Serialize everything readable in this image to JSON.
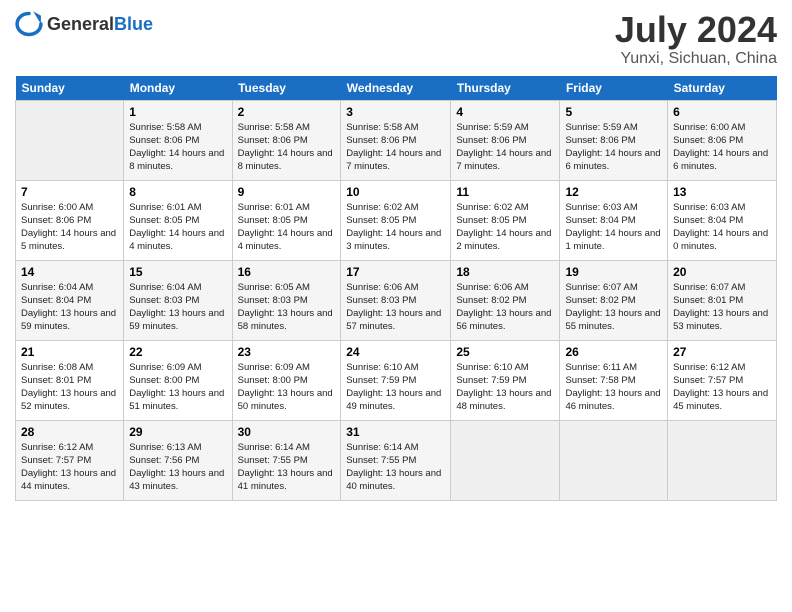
{
  "header": {
    "logo": {
      "general": "General",
      "blue": "Blue"
    },
    "title": "July 2024",
    "subtitle": "Yunxi, Sichuan, China"
  },
  "weekdays": [
    "Sunday",
    "Monday",
    "Tuesday",
    "Wednesday",
    "Thursday",
    "Friday",
    "Saturday"
  ],
  "weeks": [
    [
      {
        "day": "",
        "sunrise": "",
        "sunset": "",
        "daylight": ""
      },
      {
        "day": "1",
        "sunrise": "Sunrise: 5:58 AM",
        "sunset": "Sunset: 8:06 PM",
        "daylight": "Daylight: 14 hours and 8 minutes."
      },
      {
        "day": "2",
        "sunrise": "Sunrise: 5:58 AM",
        "sunset": "Sunset: 8:06 PM",
        "daylight": "Daylight: 14 hours and 8 minutes."
      },
      {
        "day": "3",
        "sunrise": "Sunrise: 5:58 AM",
        "sunset": "Sunset: 8:06 PM",
        "daylight": "Daylight: 14 hours and 7 minutes."
      },
      {
        "day": "4",
        "sunrise": "Sunrise: 5:59 AM",
        "sunset": "Sunset: 8:06 PM",
        "daylight": "Daylight: 14 hours and 7 minutes."
      },
      {
        "day": "5",
        "sunrise": "Sunrise: 5:59 AM",
        "sunset": "Sunset: 8:06 PM",
        "daylight": "Daylight: 14 hours and 6 minutes."
      },
      {
        "day": "6",
        "sunrise": "Sunrise: 6:00 AM",
        "sunset": "Sunset: 8:06 PM",
        "daylight": "Daylight: 14 hours and 6 minutes."
      }
    ],
    [
      {
        "day": "7",
        "sunrise": "Sunrise: 6:00 AM",
        "sunset": "Sunset: 8:06 PM",
        "daylight": "Daylight: 14 hours and 5 minutes."
      },
      {
        "day": "8",
        "sunrise": "Sunrise: 6:01 AM",
        "sunset": "Sunset: 8:05 PM",
        "daylight": "Daylight: 14 hours and 4 minutes."
      },
      {
        "day": "9",
        "sunrise": "Sunrise: 6:01 AM",
        "sunset": "Sunset: 8:05 PM",
        "daylight": "Daylight: 14 hours and 4 minutes."
      },
      {
        "day": "10",
        "sunrise": "Sunrise: 6:02 AM",
        "sunset": "Sunset: 8:05 PM",
        "daylight": "Daylight: 14 hours and 3 minutes."
      },
      {
        "day": "11",
        "sunrise": "Sunrise: 6:02 AM",
        "sunset": "Sunset: 8:05 PM",
        "daylight": "Daylight: 14 hours and 2 minutes."
      },
      {
        "day": "12",
        "sunrise": "Sunrise: 6:03 AM",
        "sunset": "Sunset: 8:04 PM",
        "daylight": "Daylight: 14 hours and 1 minute."
      },
      {
        "day": "13",
        "sunrise": "Sunrise: 6:03 AM",
        "sunset": "Sunset: 8:04 PM",
        "daylight": "Daylight: 14 hours and 0 minutes."
      }
    ],
    [
      {
        "day": "14",
        "sunrise": "Sunrise: 6:04 AM",
        "sunset": "Sunset: 8:04 PM",
        "daylight": "Daylight: 13 hours and 59 minutes."
      },
      {
        "day": "15",
        "sunrise": "Sunrise: 6:04 AM",
        "sunset": "Sunset: 8:03 PM",
        "daylight": "Daylight: 13 hours and 59 minutes."
      },
      {
        "day": "16",
        "sunrise": "Sunrise: 6:05 AM",
        "sunset": "Sunset: 8:03 PM",
        "daylight": "Daylight: 13 hours and 58 minutes."
      },
      {
        "day": "17",
        "sunrise": "Sunrise: 6:06 AM",
        "sunset": "Sunset: 8:03 PM",
        "daylight": "Daylight: 13 hours and 57 minutes."
      },
      {
        "day": "18",
        "sunrise": "Sunrise: 6:06 AM",
        "sunset": "Sunset: 8:02 PM",
        "daylight": "Daylight: 13 hours and 56 minutes."
      },
      {
        "day": "19",
        "sunrise": "Sunrise: 6:07 AM",
        "sunset": "Sunset: 8:02 PM",
        "daylight": "Daylight: 13 hours and 55 minutes."
      },
      {
        "day": "20",
        "sunrise": "Sunrise: 6:07 AM",
        "sunset": "Sunset: 8:01 PM",
        "daylight": "Daylight: 13 hours and 53 minutes."
      }
    ],
    [
      {
        "day": "21",
        "sunrise": "Sunrise: 6:08 AM",
        "sunset": "Sunset: 8:01 PM",
        "daylight": "Daylight: 13 hours and 52 minutes."
      },
      {
        "day": "22",
        "sunrise": "Sunrise: 6:09 AM",
        "sunset": "Sunset: 8:00 PM",
        "daylight": "Daylight: 13 hours and 51 minutes."
      },
      {
        "day": "23",
        "sunrise": "Sunrise: 6:09 AM",
        "sunset": "Sunset: 8:00 PM",
        "daylight": "Daylight: 13 hours and 50 minutes."
      },
      {
        "day": "24",
        "sunrise": "Sunrise: 6:10 AM",
        "sunset": "Sunset: 7:59 PM",
        "daylight": "Daylight: 13 hours and 49 minutes."
      },
      {
        "day": "25",
        "sunrise": "Sunrise: 6:10 AM",
        "sunset": "Sunset: 7:59 PM",
        "daylight": "Daylight: 13 hours and 48 minutes."
      },
      {
        "day": "26",
        "sunrise": "Sunrise: 6:11 AM",
        "sunset": "Sunset: 7:58 PM",
        "daylight": "Daylight: 13 hours and 46 minutes."
      },
      {
        "day": "27",
        "sunrise": "Sunrise: 6:12 AM",
        "sunset": "Sunset: 7:57 PM",
        "daylight": "Daylight: 13 hours and 45 minutes."
      }
    ],
    [
      {
        "day": "28",
        "sunrise": "Sunrise: 6:12 AM",
        "sunset": "Sunset: 7:57 PM",
        "daylight": "Daylight: 13 hours and 44 minutes."
      },
      {
        "day": "29",
        "sunrise": "Sunrise: 6:13 AM",
        "sunset": "Sunset: 7:56 PM",
        "daylight": "Daylight: 13 hours and 43 minutes."
      },
      {
        "day": "30",
        "sunrise": "Sunrise: 6:14 AM",
        "sunset": "Sunset: 7:55 PM",
        "daylight": "Daylight: 13 hours and 41 minutes."
      },
      {
        "day": "31",
        "sunrise": "Sunrise: 6:14 AM",
        "sunset": "Sunset: 7:55 PM",
        "daylight": "Daylight: 13 hours and 40 minutes."
      },
      {
        "day": "",
        "sunrise": "",
        "sunset": "",
        "daylight": ""
      },
      {
        "day": "",
        "sunrise": "",
        "sunset": "",
        "daylight": ""
      },
      {
        "day": "",
        "sunrise": "",
        "sunset": "",
        "daylight": ""
      }
    ]
  ]
}
